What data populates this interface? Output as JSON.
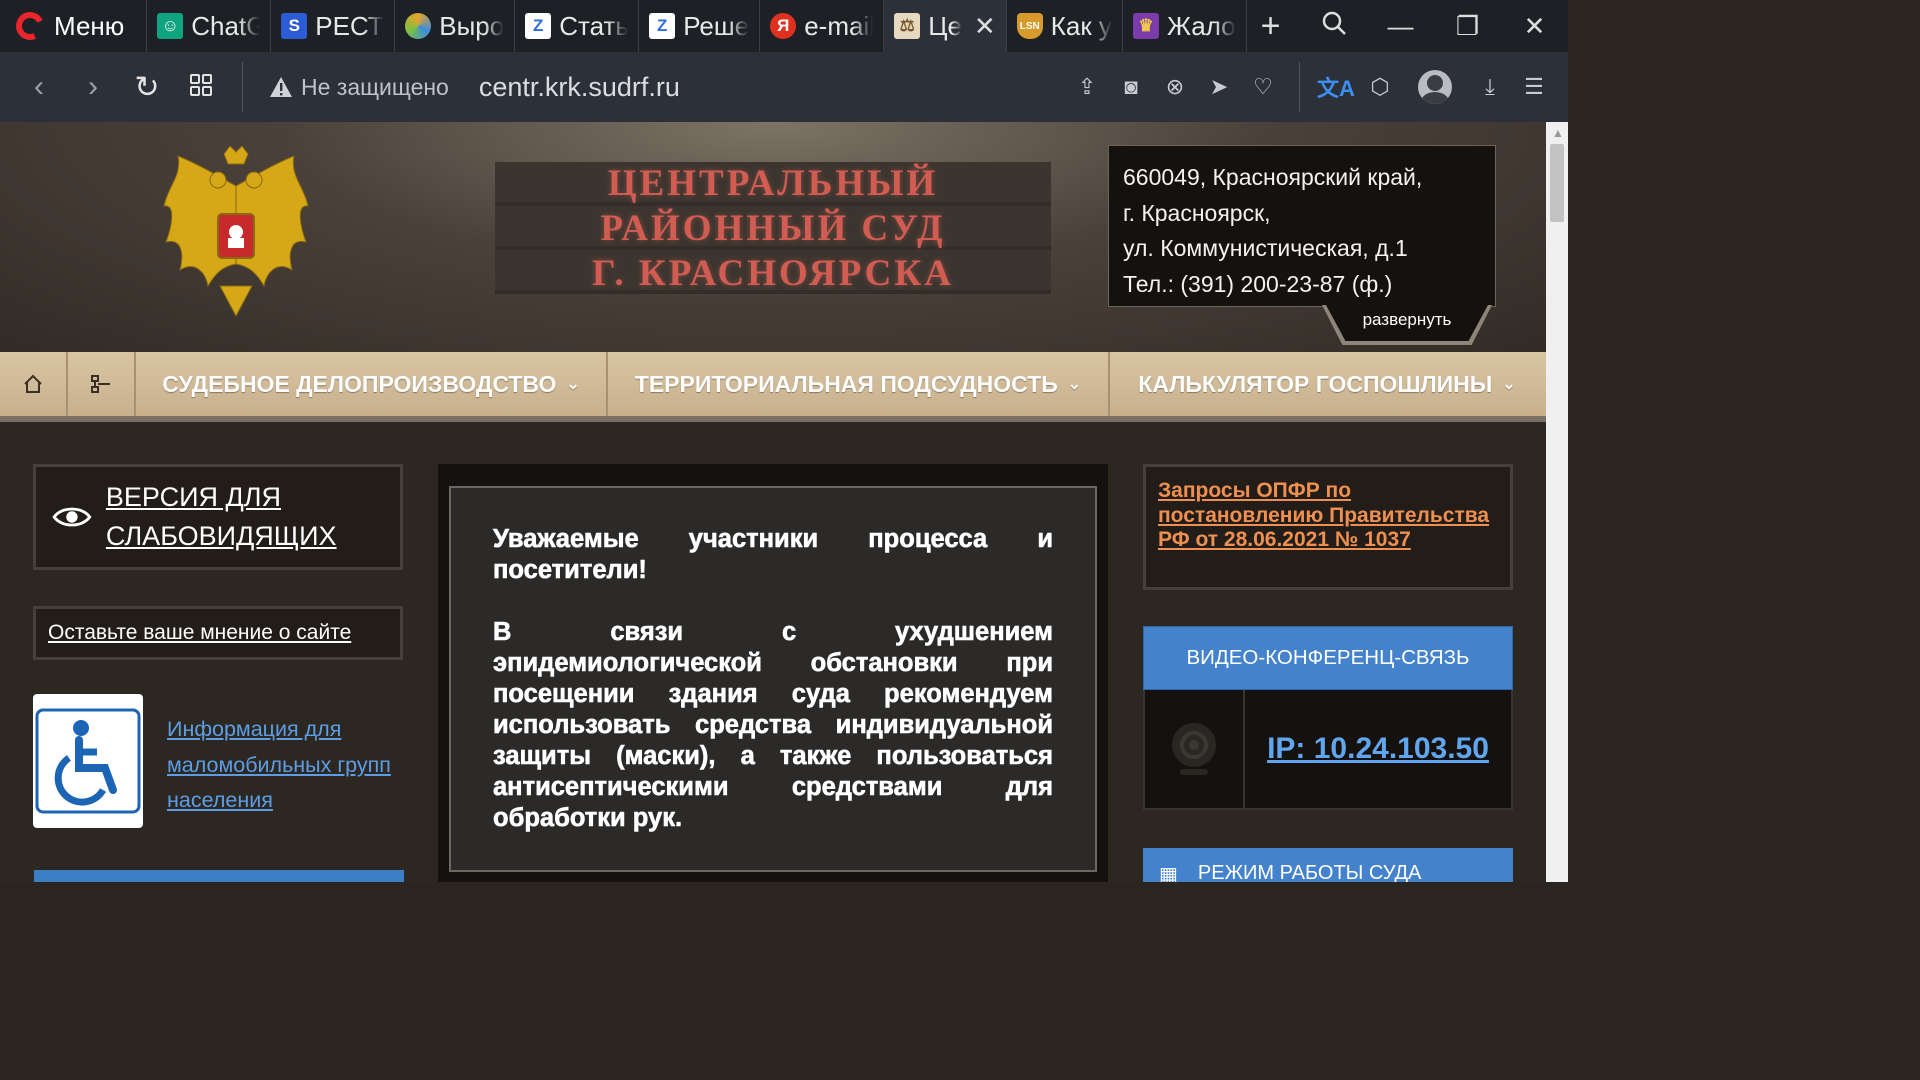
{
  "browser": {
    "menu_label": "Меню",
    "tabs": [
      {
        "label": "ChatGPT",
        "icon": "robot-icon",
        "color": "#10a37f"
      },
      {
        "label": "РЕСТАРТ",
        "icon": "s-icon",
        "color": "#2c5bd6"
      },
      {
        "label": "Выро",
        "icon": "swirl-icon",
        "color": "#e4a42a"
      },
      {
        "label": "Стать",
        "icon": "z-icon",
        "color": "#2f6fd8"
      },
      {
        "label": "Реше",
        "icon": "z-icon",
        "color": "#2f6fd8"
      },
      {
        "label": "e-mail",
        "icon": "yandex-icon",
        "color": "#e0311f"
      },
      {
        "label": "Це",
        "icon": "scales-icon",
        "color": "#e6d9c0",
        "active": true
      },
      {
        "label": "Как у",
        "icon": "shield-icon",
        "color": "#d69b2a"
      },
      {
        "label": "Жало",
        "icon": "eagle-icon",
        "color": "#7a3ca8"
      }
    ],
    "insecure_label": "Не защищено",
    "url": "centr.krk.sudrf.ru"
  },
  "header": {
    "title_lines": [
      "ЦЕНТРАЛЬНЫЙ",
      "РАЙОННЫЙ СУД",
      "Г. КРАСНОЯРСКА"
    ],
    "address_lines": [
      "660049, Красноярский край,",
      "г. Красноярск,",
      "ул. Коммунистическая, д.1",
      "Тел.: (391) 200-23-87 (ф.)"
    ],
    "expand_label": "развернуть"
  },
  "nav": {
    "items": [
      {
        "label": "СУДЕБНОЕ ДЕЛОПРОИЗВОДСТВО"
      },
      {
        "label": "ТЕРРИТОРИАЛЬНАЯ ПОДСУДНОСТЬ"
      },
      {
        "label": "КАЛЬКУЛЯТОР ГОСПОШЛИНЫ"
      }
    ]
  },
  "left": {
    "vision_link": "ВЕРСИЯ ДЛЯ СЛАБОВИДЯЩИХ",
    "opinion_link": "Оставьте ваше мнение о сайте",
    "disabled_link": "Информация для маломобильных групп населения"
  },
  "notice": {
    "greeting": "Уважаемые участники процесса и посетители!",
    "body": "В связи с ухудшением эпидемиологической обстановки при посещении здания суда рекомендуем использовать средства индивидуальной защиты (маски), а также пользоваться антисептическими средствами для обработки рук."
  },
  "right": {
    "opfr_link": "Запросы ОПФР по постановлению Правительства РФ от 28.06.2021 № 1037",
    "vcs_title": "ВИДЕО-КОНФЕРЕНЦ-СВЯЗЬ",
    "vcs_ip": "IP: 10.24.103.50",
    "mode_title": "РЕЖИМ РАБОТЫ СУДА"
  },
  "colors": {
    "accent_blue": "#4482cc",
    "link_orange": "#ef8f50",
    "title_red": "#d15c52"
  }
}
